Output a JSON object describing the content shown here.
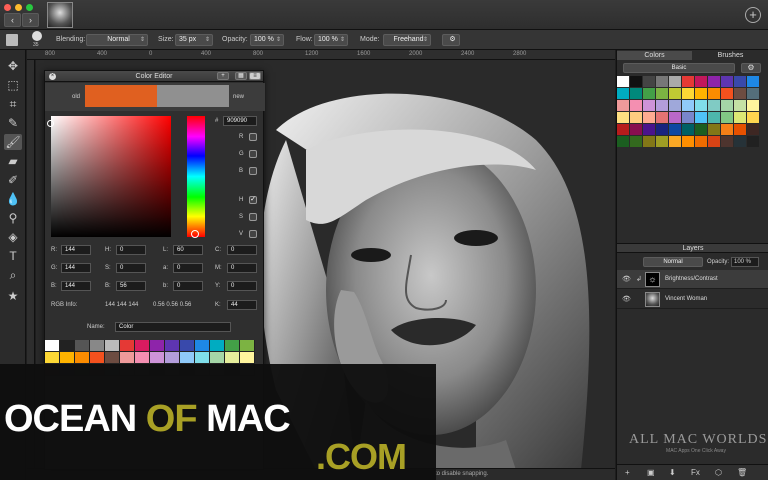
{
  "options_bar": {
    "blending_label": "Blending:",
    "blending_value": "Normal",
    "size_label": "Size:",
    "size_value": "35 px",
    "opacity_label": "Opacity:",
    "opacity_value": "100 %",
    "flow_label": "Flow:",
    "flow_value": "100 %",
    "mode_label": "Mode:",
    "mode_value": "Freehand",
    "brush_size_readout": "35"
  },
  "ruler": {
    "numbers": [
      "800",
      "400",
      "0",
      "400",
      "800",
      "1200",
      "1600",
      "2000",
      "2400",
      "2800"
    ]
  },
  "color_editor": {
    "title": "Color Editor",
    "old_label": "old",
    "new_label": "new",
    "hex_prefix": "#",
    "hex": "909090",
    "old_color": "#e06020",
    "new_color": "#909090",
    "checks": [
      {
        "label": "R",
        "checked": false
      },
      {
        "label": "G",
        "checked": false
      },
      {
        "label": "B",
        "checked": false
      },
      {
        "label": "H",
        "checked": true
      },
      {
        "label": "S",
        "checked": false
      },
      {
        "label": "V",
        "checked": false
      }
    ],
    "fields": {
      "R": "144",
      "G": "144",
      "B": "144",
      "H": "0",
      "S": "0",
      "Bv": "56",
      "L": "60",
      "a": "0",
      "b": "0",
      "C": "0",
      "M": "0",
      "Y": "0",
      "K": "44"
    },
    "rgb_info_label": "RGB Info:",
    "rgb_info_value": "144 144 144",
    "rgb_info_float": "0.56 0.56 0.56",
    "name_label": "Name:",
    "name_value": "Color",
    "swatches": [
      "#ffffff",
      "#222222",
      "#555555",
      "#888888",
      "#bbbbbb",
      "#e53935",
      "#d81b60",
      "#8e24aa",
      "#5e35b1",
      "#3949ab",
      "#1e88e5",
      "#00acc1",
      "#43a047",
      "#7cb342",
      "#fdd835",
      "#ffb300",
      "#fb8c00",
      "#f4511e",
      "#6d4c41",
      "#ef9a9a",
      "#f48fb1",
      "#ce93d8",
      "#b39ddb",
      "#90caf9",
      "#80deea",
      "#a5d6a7",
      "#e6ee9c",
      "#fff59d",
      "#3a2a1a",
      "#2a2a3a",
      "#1a3a2a",
      "#3a1a2a",
      "#2a3a3a",
      "#333333",
      "#444444",
      "#2d2d2d",
      "#3b3b3b",
      "#262626",
      "#303030",
      "#383838",
      "#2a2a2a",
      "#353535"
    ]
  },
  "right_panel": {
    "tab_colors": "Colors",
    "tab_brushes": "Brushes",
    "color_set": "Basic",
    "palette": [
      "#ffffff",
      "#111111",
      "#444444",
      "#777777",
      "#aaaaaa",
      "#e53935",
      "#c2185b",
      "#8e24aa",
      "#5e35b1",
      "#3949ab",
      "#1e88e5",
      "#00acc1",
      "#00897b",
      "#43a047",
      "#7cb342",
      "#c0ca33",
      "#fdd835",
      "#ffb300",
      "#fb8c00",
      "#f4511e",
      "#6d4c41",
      "#546e7a",
      "#ef9a9a",
      "#f48fb1",
      "#ce93d8",
      "#b39ddb",
      "#9fa8da",
      "#90caf9",
      "#80deea",
      "#80cbc4",
      "#a5d6a7",
      "#c5e1a5",
      "#fff59d",
      "#ffe082",
      "#ffcc80",
      "#ffab91",
      "#e57373",
      "#ba68c8",
      "#7986cb",
      "#4fc3f7",
      "#4db6ac",
      "#81c784",
      "#dce775",
      "#ffd54f",
      "#b71c1c",
      "#880e4f",
      "#4a148c",
      "#1a237e",
      "#0d47a1",
      "#006064",
      "#1b5e20",
      "#827717",
      "#f57f17",
      "#e65100",
      "#3e2723",
      "#1b5e20",
      "#33691e",
      "#827717",
      "#9e9d24",
      "#f9a825",
      "#ff8f00",
      "#ef6c00",
      "#d84315",
      "#4e342e",
      "#263238",
      "#212121"
    ],
    "layers_title": "Layers",
    "blend_mode": "Normal",
    "opacity_label": "Opacity:",
    "opacity_value": "100 %",
    "layers": [
      {
        "name": "Brightness/Contrast"
      },
      {
        "name": "Vincent Woman"
      }
    ],
    "footer_buttons": [
      "+",
      "▣",
      "⬇",
      "Fx",
      "⬡",
      "🗑"
    ]
  },
  "status_bar": {
    "hint": "to disable snapping."
  },
  "watermark": {
    "ocean": "OCEAN ",
    "of": "OF",
    "mac": " MAC",
    "com": ".COM",
    "allmac_title": "ALL MAC WORLDS",
    "allmac_sub": "MAC Apps One Click Away"
  }
}
